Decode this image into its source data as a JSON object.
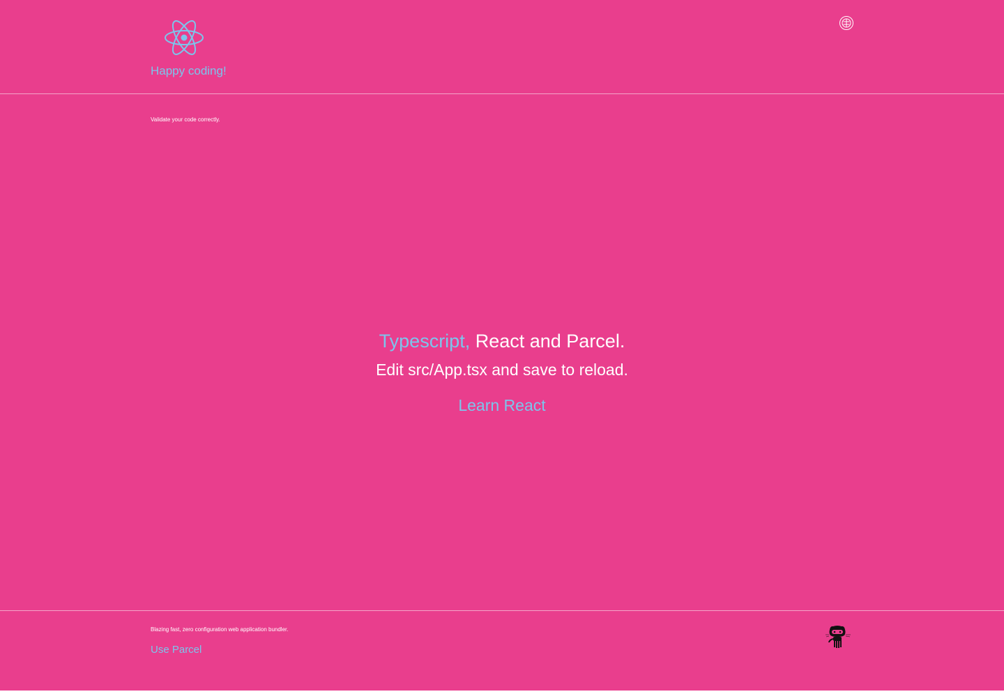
{
  "header": {
    "logo_icon": "react-atom-icon",
    "tagline": "Happy coding!",
    "top_right_icon": "parcel-globe-icon"
  },
  "main": {
    "subtitle": "Validate your code correctly.",
    "hero": {
      "accent": "Typescript,",
      "rest": " React and Parcel.",
      "instruction": "Edit src/App.tsx and save to reload."
    },
    "learn_link": "Learn React"
  },
  "footer": {
    "description": "Blazing fast, zero configuration web application bundler.",
    "link": "Use Parcel",
    "icon": "octocat-icon"
  },
  "colors": {
    "background": "#e93e8d",
    "accent": "#7cc5ec",
    "text": "#ffffff"
  }
}
